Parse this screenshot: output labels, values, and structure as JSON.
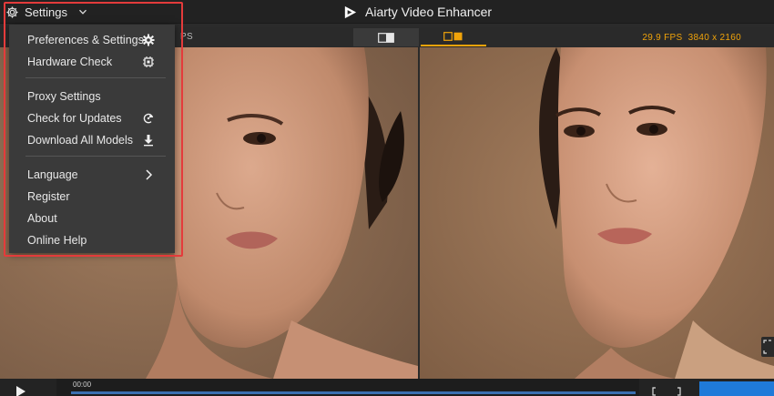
{
  "window": {
    "settings_label": "Settings",
    "app_title": "Aiarty Video Enhancer"
  },
  "viewbar": {
    "left_fps": "PS",
    "right_fps": "29.9 FPS",
    "right_resolution": "3840 x 2160",
    "active_mode": "side-by-side"
  },
  "menu": {
    "items": [
      {
        "label": "Preferences & Settings",
        "icon": "gear-icon"
      },
      {
        "label": "Hardware Check",
        "icon": "chip-icon"
      },
      {
        "label": "Proxy Settings",
        "icon": ""
      },
      {
        "label": "Check for Updates",
        "icon": "refresh-icon"
      },
      {
        "label": "Download All Models",
        "icon": "download-icon"
      },
      {
        "label": "Language",
        "icon": "chevron-right-icon"
      },
      {
        "label": "Register",
        "icon": ""
      },
      {
        "label": "About",
        "icon": ""
      },
      {
        "label": "Online Help",
        "icon": ""
      }
    ]
  },
  "player": {
    "current_time": "00:00"
  },
  "colors": {
    "accent": "#f0a30a",
    "highlight": "#e43b3b",
    "export": "#1f7ad9",
    "menu_bg": "#3a3a3a",
    "titlebar_bg": "#222222"
  }
}
